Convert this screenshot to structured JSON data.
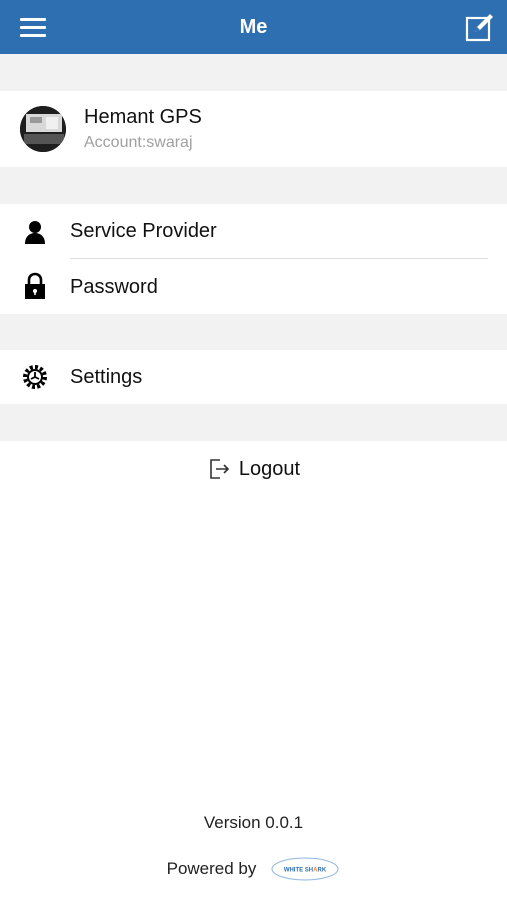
{
  "header": {
    "title": "Me",
    "menu_icon": "hamburger-menu-icon",
    "edit_icon": "edit-icon",
    "background": "#2d6fb0"
  },
  "profile": {
    "name": "Hemant GPS",
    "account": "Account:swaraj"
  },
  "menu": {
    "service_provider": {
      "label": "Service Provider",
      "icon": "person-icon"
    },
    "password": {
      "label": "Password",
      "icon": "lock-icon"
    },
    "settings": {
      "label": "Settings",
      "icon": "gear-icon"
    }
  },
  "logout": {
    "label": "Logout",
    "icon": "logout-icon"
  },
  "footer": {
    "version": "Version 0.0.1",
    "powered_by": "Powered by",
    "logo_text": "WHITE SHARK"
  },
  "colors": {
    "header": "#2d6fb0",
    "section_gap": "#f2f2f2",
    "secondary_text": "#a0a0a0"
  }
}
